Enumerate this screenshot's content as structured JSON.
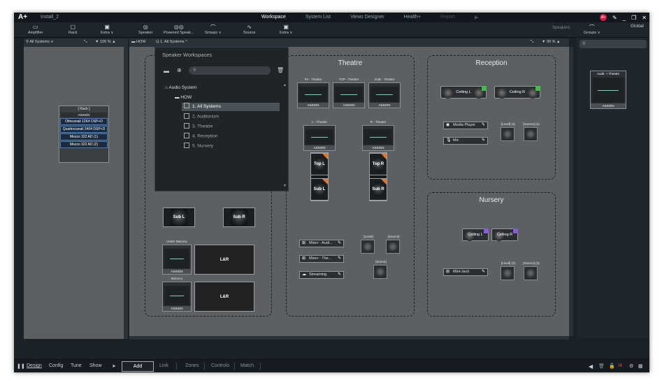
{
  "titlebar": {
    "logo": "A+",
    "install_tab": "Install_2",
    "tabs": [
      "Workspace",
      "System List",
      "Views Designer",
      "Health+",
      "Report"
    ],
    "avatar": "A+"
  },
  "toolbar": {
    "items": [
      "Amplifier",
      "Rack",
      "Extra ∨",
      "Speaker",
      "Powered Speak...",
      "Groups ∨",
      "Source",
      "Extra ∨"
    ],
    "speakers_label": "Speakers",
    "groups_right": "Groups ∨",
    "global_label": "Global"
  },
  "left_panel": {
    "selector": "All Systems ∨",
    "zoom": "100 %",
    "rack": {
      "title": "[ Rack ]",
      "assign": "ASSIGN",
      "devices": [
        "Ottocanali 12K4 DSP+D",
        "Quattrocanali 2404 DSP+D",
        "Mezzo 322 AD (1)",
        "Mezzo 322 AD (2)"
      ]
    }
  },
  "main_panel": {
    "breadcrumb_root": "HOW",
    "breadcrumb_current": "1. All Systems ^",
    "zoom": "90 %"
  },
  "speaker_workspaces": {
    "title": "Speaker Workspaces",
    "search_placeholder": "",
    "tree": {
      "root": "Audio System",
      "folder": "HOW",
      "items": [
        "1. All Systems",
        "2. Auditorium",
        "3. Theatre",
        "4. Reception",
        "5. Nursery"
      ]
    }
  },
  "zones": {
    "theatre": "Theatre",
    "reception": "Reception",
    "nursery": "Nursery"
  },
  "theatre": {
    "devices": [
      {
        "label": "PA - Theatre",
        "assign": "ASSIGN"
      },
      {
        "label": "TOP - Theatre",
        "assign": "ASSIGN"
      },
      {
        "label": "SUB - Theatre",
        "assign": "ASSIGN"
      },
      {
        "label": "L - Theatre",
        "assign": "ASSIGN"
      },
      {
        "label": "R - Theatre",
        "assign": "ASSIGN"
      }
    ],
    "speakers": [
      "Top L",
      "Sub L",
      "Top R",
      "Sub R"
    ],
    "chips": [
      "Mixer - Audi...",
      "Mixer - The...",
      "Streaming"
    ],
    "knobs": [
      "[Level]",
      "[Source]",
      "[Scene]"
    ]
  },
  "auditorium": {
    "speakers": [
      "Sub L",
      "Sub R"
    ],
    "groups": [
      {
        "label": "Under Balcony",
        "assign": "ASSIGN",
        "speaker": "L&R"
      },
      {
        "label": "Balcony",
        "assign": "ASSIGN",
        "speaker": "L&R"
      }
    ]
  },
  "reception": {
    "ceilings": [
      "Ceiling L",
      "Ceiling R"
    ],
    "chips": [
      "Media Player",
      "Mic"
    ],
    "knobs": [
      "[Level] (2)",
      "[Source] (2)"
    ],
    "tag_color": "#3fbf4a"
  },
  "nursery": {
    "ceilings": [
      "Ceiling L",
      "Ceiling R"
    ],
    "chips": [
      "Mini-Jack"
    ],
    "knobs": [
      "[Level] (3)",
      "[Source] (3)"
    ],
    "tag_color": "#8a5cd6"
  },
  "right_panel": {
    "card_label": "Audit. + Theatre",
    "card_assign": "ASSIGN"
  },
  "statusbar": {
    "modes": [
      "Design",
      "Config",
      "Tune",
      "Show"
    ],
    "tabs": [
      "Add",
      "Link",
      "Zones",
      "Controls",
      "Match"
    ],
    "page": "/4"
  }
}
